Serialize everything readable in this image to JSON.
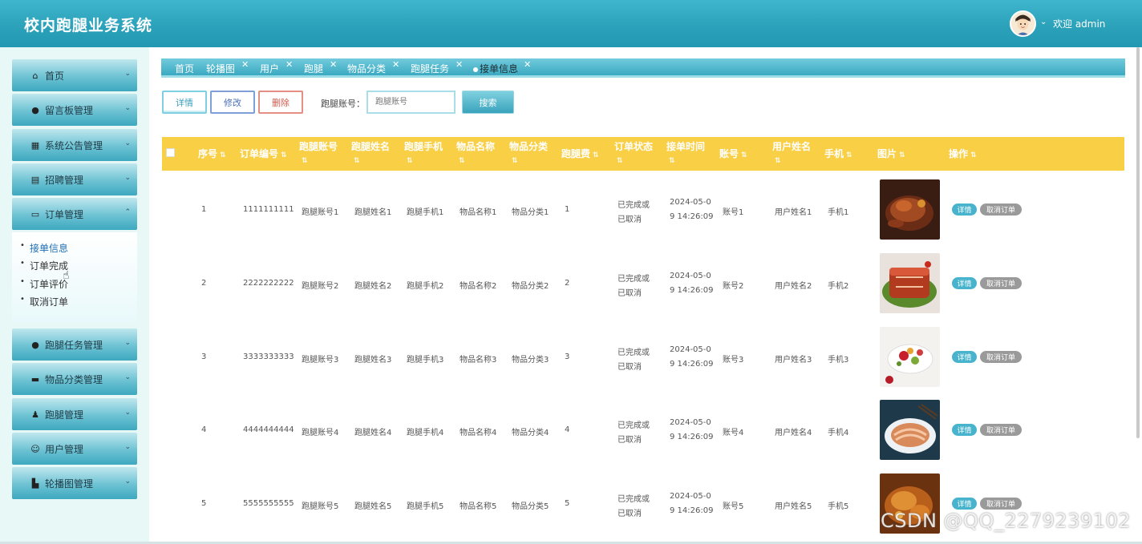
{
  "app": {
    "title": "校内跑腿业务系统",
    "welcome": "欢迎 admin"
  },
  "sidebar": {
    "items": [
      {
        "label": "首页",
        "icon": "home-icon",
        "glyph": "⌂"
      },
      {
        "label": "留言板管理",
        "icon": "message-icon",
        "glyph": "●"
      },
      {
        "label": "系统公告管理",
        "icon": "grid-icon",
        "glyph": "▦"
      },
      {
        "label": "招聘管理",
        "icon": "building-icon",
        "glyph": "▤"
      },
      {
        "label": "订单管理",
        "icon": "card-icon",
        "glyph": "▭"
      },
      {
        "label": "跑腿任务管理",
        "icon": "drop-icon",
        "glyph": "●"
      },
      {
        "label": "物品分类管理",
        "icon": "box-icon",
        "glyph": "▬"
      },
      {
        "label": "跑腿管理",
        "icon": "user-icon",
        "glyph": "♟"
      },
      {
        "label": "用户管理",
        "icon": "user-outline-icon",
        "glyph": "☺"
      },
      {
        "label": "轮播图管理",
        "icon": "image-icon",
        "glyph": "▙"
      }
    ],
    "order_submenu": [
      "接单信息",
      "订单完成",
      "订单评价",
      "取消订单"
    ]
  },
  "tabs": [
    "首页",
    "轮播图",
    "用户",
    "跑腿",
    "物品分类",
    "跑腿任务",
    "接单信息"
  ],
  "toolbar": {
    "detail": "详情",
    "edit": "修改",
    "delete": "删除",
    "search_label": "跑腿账号：",
    "search_placeholder": "跑腿账号",
    "search_button": "搜索"
  },
  "table": {
    "header_color": "#f9cf46",
    "columns": [
      "序号",
      "订单编号",
      "跑腿账号",
      "跑腿姓名",
      "跑腿手机",
      "物品名称",
      "物品分类",
      "跑腿费",
      "订单状态",
      "接单时间",
      "账号",
      "用户姓名",
      "手机",
      "图片",
      "操作"
    ],
    "row_actions": {
      "detail": "详情",
      "cancel": "取消订单"
    },
    "rows": [
      {
        "seq": "1",
        "order_no": "1111111111",
        "runner_account": "跑腿账号1",
        "runner_name": "跑腿姓名1",
        "runner_phone": "跑腿手机1",
        "item_name": "物品名称1",
        "item_category": "物品分类1",
        "fee": "1",
        "status_l1": "已完成或",
        "status_l2": "已取消",
        "time_l1": "2024-05-0",
        "time_l2": "9 14:26:09",
        "account": "账号1",
        "user_name": "用户姓名1",
        "phone": "手机1",
        "image": "roast-chicken-image"
      },
      {
        "seq": "2",
        "order_no": "2222222222",
        "runner_account": "跑腿账号2",
        "runner_name": "跑腿姓名2",
        "runner_phone": "跑腿手机2",
        "item_name": "物品名称2",
        "item_category": "物品分类2",
        "fee": "2",
        "status_l1": "已完成或",
        "status_l2": "已取消",
        "time_l1": "2024-05-0",
        "time_l2": "9 14:26:09",
        "account": "账号2",
        "user_name": "用户姓名2",
        "phone": "手机2",
        "image": "braised-pork-image"
      },
      {
        "seq": "3",
        "order_no": "3333333333",
        "runner_account": "跑腿账号3",
        "runner_name": "跑腿姓名3",
        "runner_phone": "跑腿手机3",
        "item_name": "物品名称3",
        "item_category": "物品分类3",
        "fee": "3",
        "status_l1": "已完成或",
        "status_l2": "已取消",
        "time_l1": "2024-05-0",
        "time_l2": "9 14:26:09",
        "account": "账号3",
        "user_name": "用户姓名3",
        "phone": "手机3",
        "image": "salad-plate-image"
      },
      {
        "seq": "4",
        "order_no": "4444444444",
        "runner_account": "跑腿账号4",
        "runner_name": "跑腿姓名4",
        "runner_phone": "跑腿手机4",
        "item_name": "物品名称4",
        "item_category": "物品分类4",
        "fee": "4",
        "status_l1": "已完成或",
        "status_l2": "已取消",
        "time_l1": "2024-05-0",
        "time_l2": "9 14:26:09",
        "account": "账号4",
        "user_name": "用户姓名4",
        "phone": "手机4",
        "image": "sliced-meat-image"
      },
      {
        "seq": "5",
        "order_no": "5555555555",
        "runner_account": "跑腿账号5",
        "runner_name": "跑腿姓名5",
        "runner_phone": "跑腿手机5",
        "item_name": "物品名称5",
        "item_category": "物品分类5",
        "fee": "5",
        "status_l1": "已完成或",
        "status_l2": "已取消",
        "time_l1": "2024-05-0",
        "time_l2": "9 14:26:09",
        "account": "账号5",
        "user_name": "用户姓名5",
        "phone": "手机5",
        "image": "grilled-chicken-image"
      }
    ]
  },
  "watermark": "CSDN @QQ_2279239102"
}
